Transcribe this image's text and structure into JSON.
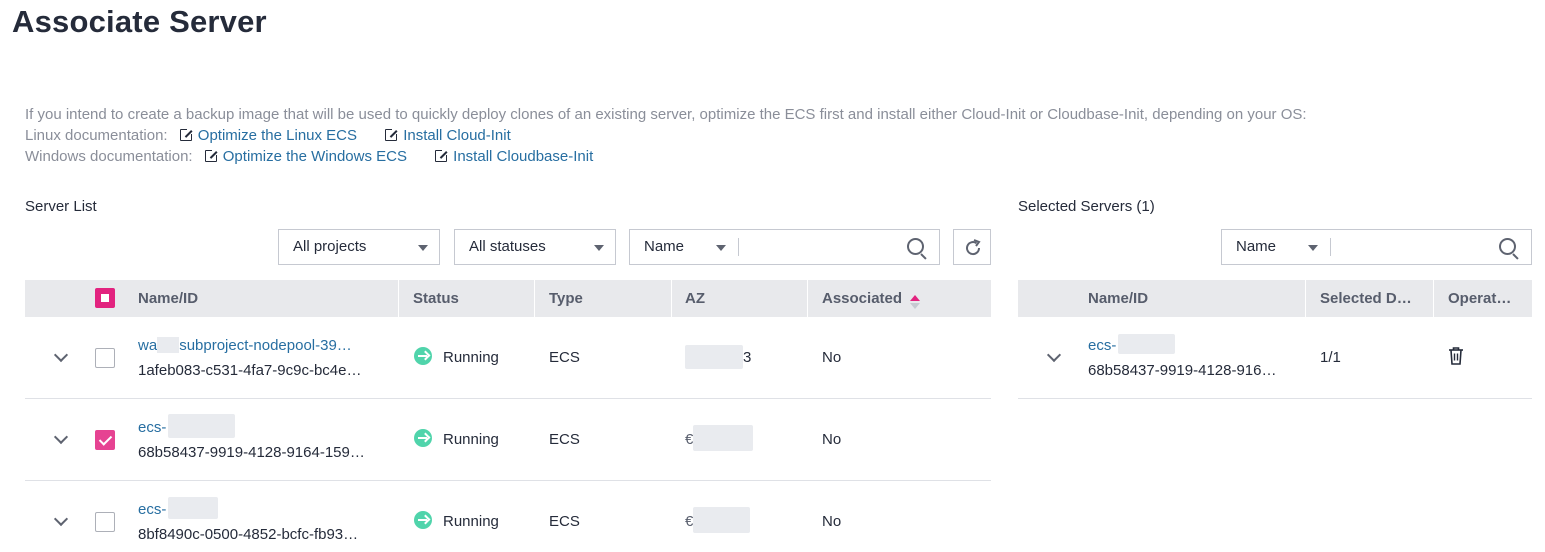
{
  "page_title": "Associate Server",
  "info": {
    "intro": "If you intend to create a backup image that will be used to quickly deploy clones of an existing server, optimize the ECS first and install either Cloud-Init or Cloudbase-Init, depending on your OS:",
    "linux_label": "Linux documentation:",
    "linux_links": [
      "Optimize the Linux ECS",
      "Install Cloud-Init"
    ],
    "windows_label": "Windows documentation:",
    "windows_links": [
      "Optimize the Windows ECS",
      "Install Cloudbase-Init"
    ]
  },
  "server_list": {
    "label": "Server List",
    "filters": {
      "project": "All projects",
      "status": "All statuses",
      "search_field": "Name",
      "search_value": ""
    },
    "columns": [
      "Name/ID",
      "Status",
      "Type",
      "AZ",
      "Associated"
    ],
    "sort_column": "Associated",
    "rows": [
      {
        "name_pre": "wa",
        "name_post": "subproject-nodepool-39…",
        "id": "1afeb083-c531-4fa7-9c9c-bc4e…",
        "status": "Running",
        "type": "ECS",
        "az_suffix": "3",
        "associated": "No",
        "checked": false
      },
      {
        "name_pre": "ecs-",
        "name_post": "",
        "id": "68b58437-9919-4128-9164-159…",
        "status": "Running",
        "type": "ECS",
        "az_prefix": "€",
        "associated": "No",
        "checked": true
      },
      {
        "name_pre": "ecs-",
        "name_post": "",
        "id": "8bf8490c-0500-4852-bcfc-fb93…",
        "status": "Running",
        "type": "ECS",
        "az_prefix": "€",
        "associated": "No",
        "checked": false
      }
    ]
  },
  "selected_servers": {
    "label": "Selected Servers (1)",
    "search_field": "Name",
    "search_value": "",
    "columns": [
      "Name/ID",
      "Selected D…",
      "Operat…"
    ],
    "rows": [
      {
        "name_pre": "ecs-",
        "id": "68b58437-9919-4128-916…",
        "selected": "1/1"
      }
    ]
  },
  "colors": {
    "accent": "#e2237f",
    "link": "#276ea1",
    "running": "#50d4ab",
    "header_bg": "#e8e9ec"
  }
}
